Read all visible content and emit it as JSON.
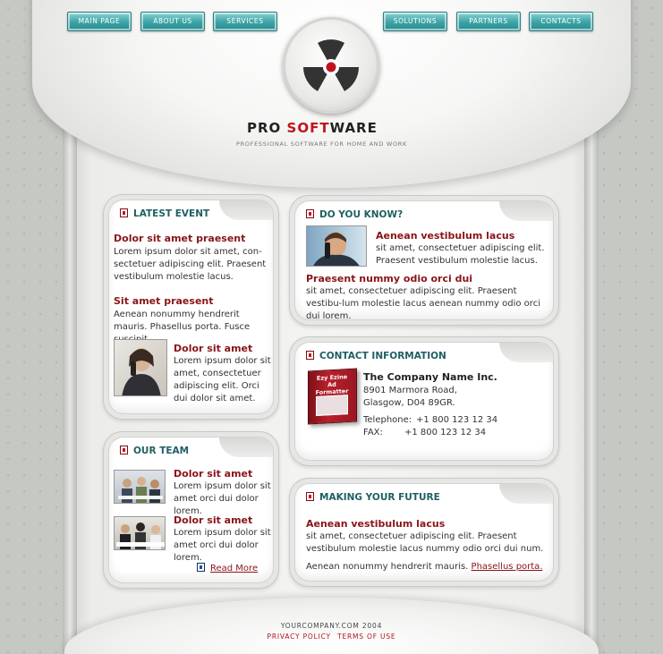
{
  "nav": {
    "items": [
      {
        "label": "Main Page"
      },
      {
        "label": "About Us"
      },
      {
        "label": "Services"
      },
      {
        "label": "Solutions"
      },
      {
        "label": "Partners"
      },
      {
        "label": "Contacts"
      }
    ]
  },
  "brand": {
    "name_part1": "PRO ",
    "name_accent": "SOFT",
    "name_part2": "WARE",
    "tagline": "Professional software for home and work"
  },
  "latest_event": {
    "title": "Latest Event",
    "item1": {
      "heading": "Dolor sit amet praesent",
      "body": "Lorem ipsum dolor sit amet, con-sectetuer adipiscing elit. Praesent vestibulum molestie lacus."
    },
    "item2": {
      "heading": "Sit amet praesent",
      "body": "Aenean nonummy hendrerit mauris. Phasellus porta. Fusce suscipit."
    },
    "item3": {
      "heading": "Dolor sit amet",
      "body": "Lorem ipsum dolor sit amet, consectetuer adipiscing elit. Orci dui dolor sit amet."
    }
  },
  "our_team": {
    "title": "Our Team",
    "item1": {
      "heading": "Dolor sit amet",
      "body": "Lorem ipsum dolor sit amet orci dui dolor lorem."
    },
    "item2": {
      "heading": "Dolor sit amet",
      "body": "Lorem ipsum dolor sit amet orci dui dolor lorem."
    },
    "read_more": "Read More"
  },
  "do_you_know": {
    "title": "Do You Know?",
    "item1": {
      "heading": "Aenean vestibulum lacus",
      "body": "sit amet, consectetuer adipiscing elit. Praesent vestibulum molestie lacus."
    },
    "item2": {
      "heading": "Praesent nummy odio orci dui",
      "body": "sit amet, consectetuer adipiscing elit. Praesent vestibu-lum molestie lacus aenean nummy odio orci dui lorem."
    }
  },
  "contact": {
    "title": "Contact Information",
    "box_label": "Ezy Ezine Ad Formatter",
    "company": "The Company Name Inc.",
    "address1": "8901 Marmora Road,",
    "address2": "Glasgow, D04 89GR.",
    "telephone_label": "Telephone:",
    "telephone": "+1 800 123 12 34",
    "fax_label": "FAX:",
    "fax": "+1 800 123 12 34"
  },
  "future": {
    "title": "Making Your Future",
    "heading": "Aenean vestibulum lacus",
    "body": "sit amet, consectetuer adipiscing elit. Praesent vestibulum molestie lacus nummy odio orci dui num.",
    "body2": "Aenean nonummy hendrerit mauris.",
    "link": "Phasellus porta."
  },
  "footer": {
    "copyright": "YourCompany.com  2004",
    "privacy": "Privacy Policy",
    "terms": "Terms of Use"
  },
  "colors": {
    "accent": "#c0141c",
    "heading": "#8a1418",
    "title": "#1f5f63",
    "nav": "#3aa3a6"
  }
}
